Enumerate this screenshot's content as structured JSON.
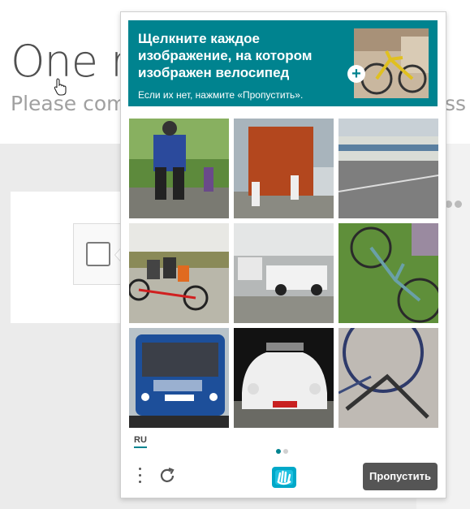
{
  "background_page": {
    "title": "One r",
    "subtitle": "Please com",
    "subtitle_right": "ss"
  },
  "challenge": {
    "prompt": {
      "instruction": "Щелкните каждое изображение, на котором изображен велосипед",
      "hint": "Если их нет, нажмите «Пропустить»."
    },
    "tiles": [
      {
        "subject": "cyclists-on-road"
      },
      {
        "subject": "shipping-container-truck"
      },
      {
        "subject": "train-at-platform"
      },
      {
        "subject": "tandem-bicycle-riders"
      },
      {
        "subject": "pickup-truck-in-lot"
      },
      {
        "subject": "bicycle-in-grass"
      },
      {
        "subject": "city-bus"
      },
      {
        "subject": "vw-beetle-car"
      },
      {
        "subject": "bicycle-wheel-closeup"
      }
    ],
    "language": "RU",
    "page_indicator": {
      "current": 1,
      "total": 2
    },
    "skip_label": "Пропустить"
  },
  "colors": {
    "accent": "#00838f",
    "skip_button": "#555555",
    "background_grey": "#ebebeb"
  }
}
